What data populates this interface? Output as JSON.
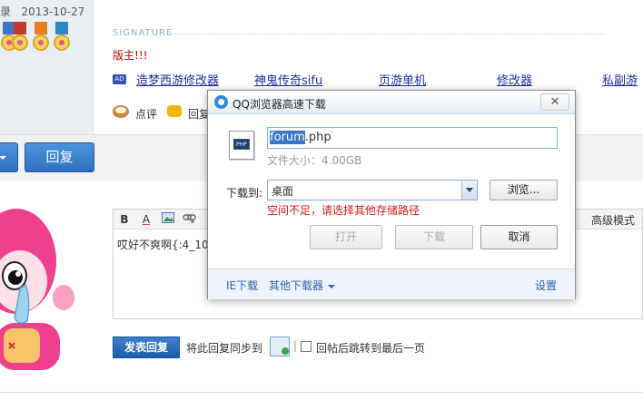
{
  "post": {
    "header_text": "录",
    "date": "2013-10-27",
    "signature_label": "SIGNATURE",
    "signature_text": "版主!!!",
    "ad_badge": "AD",
    "ad_links": [
      "造梦西游修改器",
      "神鬼传奇sifu",
      "页游单机",
      "修改器",
      "私副游"
    ],
    "comment_label": "点评",
    "reply_label": "回复"
  },
  "reply_bar": {
    "reply_button": "回复"
  },
  "editor": {
    "toolbar": {
      "bold": "B",
      "font_color": "A",
      "advanced_mode": "高级模式"
    },
    "content": "哎好不爽啊{:4_10"
  },
  "submit": {
    "submit_button": "发表回复",
    "sync_label": "将此回复同步到",
    "separator": "|",
    "jump_label": "回帖后跳转到最后一页"
  },
  "dialog": {
    "title": "QQ浏览器高速下载",
    "close_glyph": "✕",
    "file_icon_text": "PHP",
    "filename_selected": "forum",
    "filename_ext": ".php",
    "file_size": "文件大小：4.00GB",
    "download_to_label": "下载到:",
    "download_location": "桌面",
    "browse_button": "浏览...",
    "space_warning": "空间不足，请选择其他存储路径",
    "open_button": "打开",
    "download_button": "下载",
    "cancel_button": "取消",
    "footer": {
      "ie_download": "IE下载",
      "other_downloaders": "其他下载器",
      "settings": "设置"
    }
  },
  "colors": {
    "accent_blue": "#2d6fbe",
    "link_blue": "#1b2e99",
    "warning_red": "#d21b1b",
    "signature_red": "#cc0000"
  }
}
